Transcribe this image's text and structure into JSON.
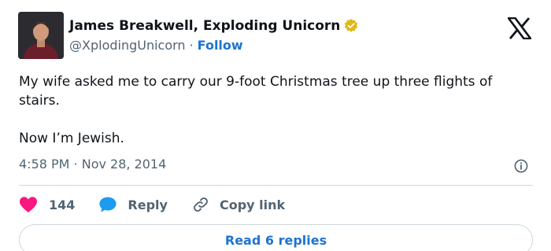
{
  "author": {
    "name": "James Breakwell, Exploding Unicorn",
    "handle": "@XplodingUnicorn",
    "separator": "·",
    "follow_label": "Follow"
  },
  "tweet": {
    "line1": "My wife asked me to carry our 9-foot Christmas tree up three flights of stairs.",
    "line2": "Now I’m Jewish.",
    "timestamp": "4:58 PM · Nov 28, 2014"
  },
  "actions": {
    "like_count": "144",
    "reply_label": "Reply",
    "copy_link_label": "Copy link"
  },
  "footer": {
    "read_replies_label": "Read 6 replies"
  },
  "icons": {
    "verified": "verified-badge-icon",
    "brand": "x-logo-icon",
    "info": "info-icon",
    "like": "heart-icon",
    "reply": "speech-bubble-icon",
    "copy_link": "link-icon"
  },
  "colors": {
    "like": "#f91880",
    "reply": "#1d9bf0",
    "link_blue": "#1d74d1",
    "verified_gold": "#e2b719"
  }
}
